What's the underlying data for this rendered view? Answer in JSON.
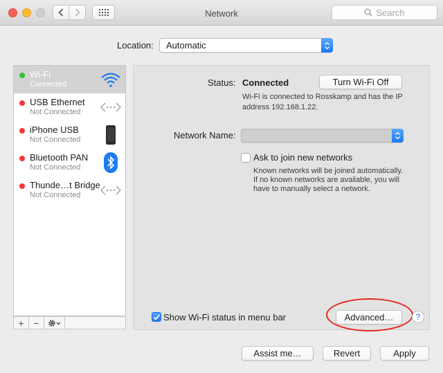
{
  "window": {
    "title": "Network",
    "search_placeholder": "Search"
  },
  "location": {
    "label": "Location:",
    "value": "Automatic"
  },
  "services": [
    {
      "name": "Wi-Fi",
      "status": "Connected",
      "status_color": "green",
      "icon": "wifi-icon",
      "selected": true
    },
    {
      "name": "USB Ethernet",
      "status": "Not Connected",
      "status_color": "red",
      "icon": "ethernet-icon"
    },
    {
      "name": "iPhone USB",
      "status": "Not Connected",
      "status_color": "red",
      "icon": "iphone-icon"
    },
    {
      "name": "Bluetooth PAN",
      "status": "Not Connected",
      "status_color": "red",
      "icon": "bluetooth-icon"
    },
    {
      "name": "Thunde…t Bridge",
      "status": "Not Connected",
      "status_color": "red",
      "icon": "thunderbolt-bridge-icon"
    }
  ],
  "sidebar_actions": {
    "add": "+",
    "remove": "−"
  },
  "detail": {
    "status_label": "Status:",
    "status_value": "Connected",
    "toggle_button": "Turn Wi-Fi Off",
    "status_description": "Wi-Fi is connected to Rosskamp and has the IP address 192.168.1.22.",
    "network_name_label": "Network Name:",
    "network_name_value": "",
    "ask_join_label": "Ask to join new networks",
    "ask_join_checked": false,
    "ask_join_description": "Known networks will be joined automatically. If no known networks are available, you will have to manually select a network.",
    "menu_bar_label": "Show Wi-Fi status in menu bar",
    "menu_bar_checked": true,
    "advanced_button": "Advanced…",
    "help": "?"
  },
  "footer": {
    "assist_button": "Assist me…",
    "revert_button": "Revert",
    "apply_button": "Apply"
  },
  "colors": {
    "accent": "#1f78f0",
    "status_green": "#2fc23a",
    "status_red": "#f0373b",
    "annotation_ring": "#e5291e"
  }
}
